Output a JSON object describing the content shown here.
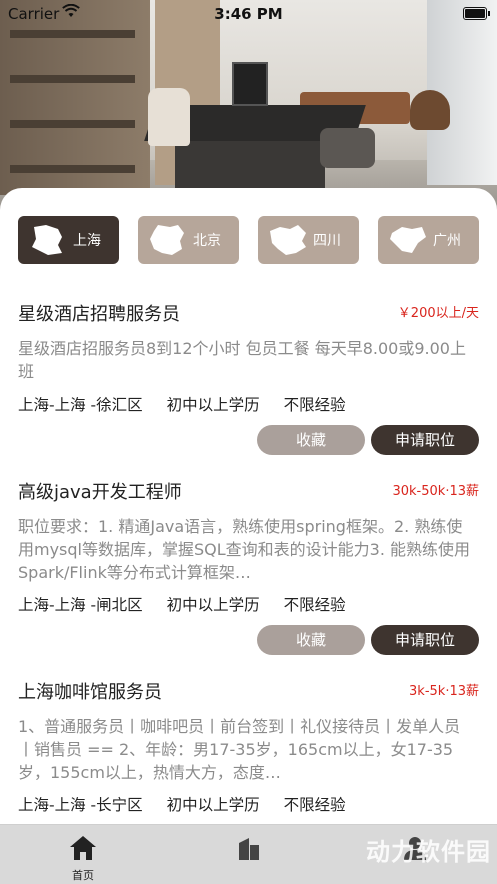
{
  "status_bar": {
    "carrier": "Carrier",
    "time": "3:46 PM"
  },
  "hero": {
    "image": "office-interior-photo"
  },
  "cities": [
    {
      "label": "上海",
      "icon": "shanghai-map-icon",
      "active": true
    },
    {
      "label": "北京",
      "icon": "beijing-map-icon",
      "active": false
    },
    {
      "label": "四川",
      "icon": "sichuan-map-icon",
      "active": false
    },
    {
      "label": "广州",
      "icon": "guangzhou-map-icon",
      "active": false
    }
  ],
  "jobs": [
    {
      "title": "星级酒店招聘服务员",
      "salary": "￥200以上/天",
      "description": "星级酒店招服务员8到12个小时 包员工餐 每天早8.00或9.00上班",
      "location": "上海-上海 -徐汇区",
      "education": "初中以上学历",
      "experience": "不限经验",
      "favorite_label": "收藏",
      "apply_label": "申请职位"
    },
    {
      "title": "高级java开发工程师",
      "salary": "30k-50k·13薪",
      "description": "职位要求：1. 精通Java语言，熟练使用spring框架。2. 熟练使用mysql等数据库，掌握SQL查询和表的设计能力3. 能熟练使用Spark/Flink等分布式计算框架…",
      "location": "上海-上海 -闸北区",
      "education": "初中以上学历",
      "experience": "不限经验",
      "favorite_label": "收藏",
      "apply_label": "申请职位"
    },
    {
      "title": "上海咖啡馆服务员",
      "salary": "3k-5k·13薪",
      "description": "1、普通服务员丨咖啡吧员丨前台签到丨礼仪接待员丨发单人员丨销售员 == 2、年龄：男17-35岁，165cm以上，女17-35岁，155cm以上，热情大方，态度…",
      "location": "上海-上海 -长宁区",
      "education": "初中以上学历",
      "experience": "不限经验"
    }
  ],
  "tabbar": {
    "tabs": [
      {
        "label": "首页",
        "icon": "home-icon",
        "active": true
      },
      {
        "label": "",
        "icon": "building-icon",
        "active": false
      },
      {
        "label": "",
        "icon": "person-icon",
        "active": false
      }
    ]
  },
  "watermark": "动力软件园",
  "colors": {
    "accent_dark": "#3e342f",
    "accent_light": "#b6a69a",
    "salary_red": "#d9251d"
  }
}
